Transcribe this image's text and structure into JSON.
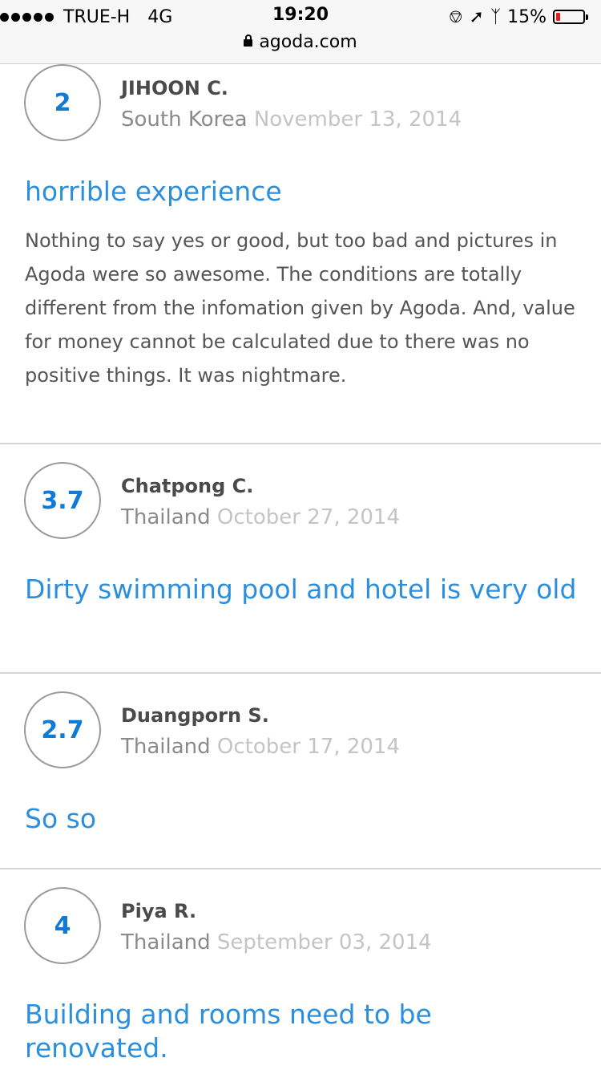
{
  "status_bar": {
    "carrier": "TRUE-H",
    "network": "4G",
    "time": "19:20",
    "battery": "15%",
    "battery_level": 0.15,
    "url": "agoda.com"
  },
  "reviews": [
    {
      "score": "2",
      "name": "JIHOON C.",
      "country": "South Korea",
      "date": "November 13, 2014",
      "title": "horrible experience",
      "body": "Nothing to say yes or good, but too bad and pictures in Agoda were so awesome. The conditions are totally different from the infomation given by Agoda. And, value for money cannot be calculated due to there was no positive things. It was nightmare."
    },
    {
      "score": "3.7",
      "name": "Chatpong C.",
      "country": "Thailand",
      "date": "October 27, 2014",
      "title": "Dirty swimming pool and hotel is very old"
    },
    {
      "score": "2.7",
      "name": "Duangporn S.",
      "country": "Thailand",
      "date": "October 17, 2014",
      "title": "So so"
    },
    {
      "score": "4",
      "name": "Piya R.",
      "country": "Thailand",
      "date": "September 03, 2014",
      "title": "Building and rooms need to be renovated."
    }
  ]
}
